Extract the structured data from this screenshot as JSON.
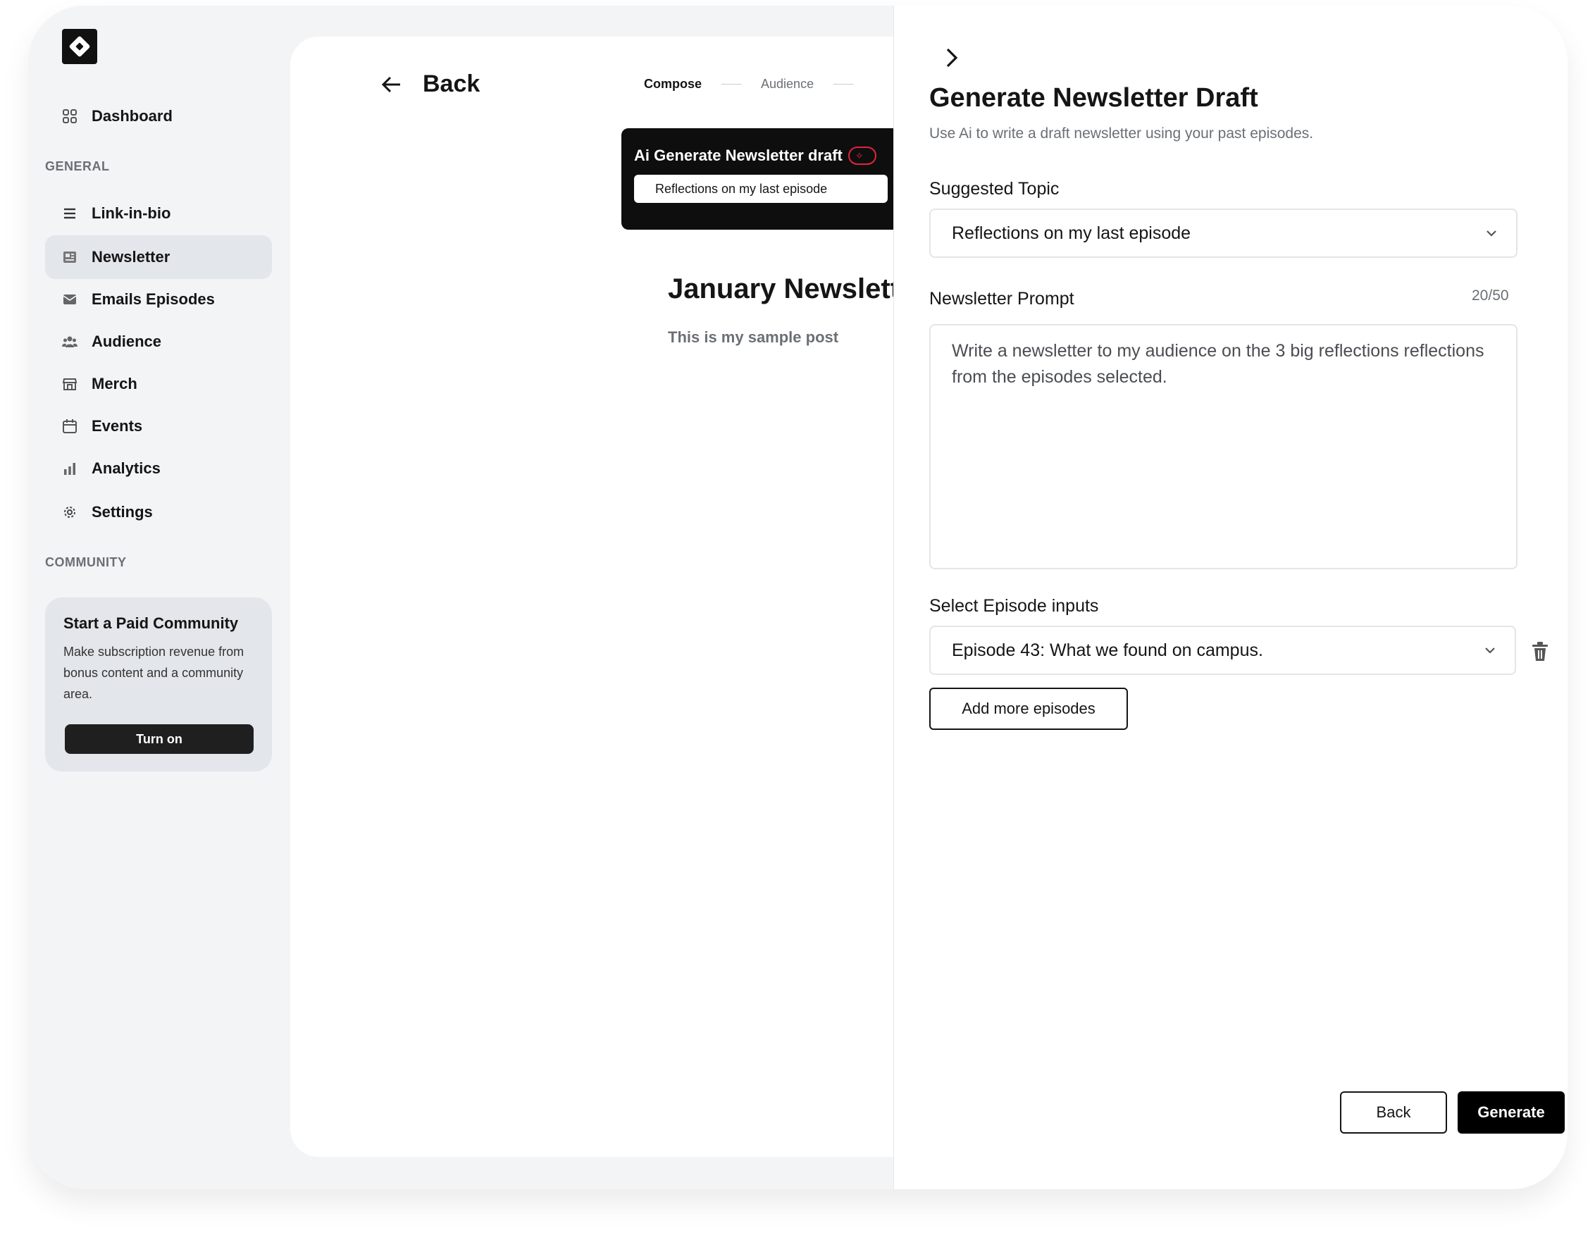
{
  "sidebar": {
    "logo": "logo-diamond",
    "items": [
      {
        "label": "Dashboard",
        "icon": "grid-icon"
      },
      {
        "label": "Link-in-bio",
        "icon": "list-icon"
      },
      {
        "label": "Newsletter",
        "icon": "newspaper-icon",
        "active": true
      },
      {
        "label": "Emails Episodes",
        "icon": "mail-icon"
      },
      {
        "label": "Audience",
        "icon": "people-icon"
      },
      {
        "label": "Merch",
        "icon": "store-icon"
      },
      {
        "label": "Events",
        "icon": "calendar-icon"
      },
      {
        "label": "Analytics",
        "icon": "bar-chart-icon"
      },
      {
        "label": "Settings",
        "icon": "gear-icon"
      }
    ],
    "section_general": "GENERAL",
    "section_community": "COMMUNITY",
    "community_card": {
      "title": "Start a Paid Community",
      "text": "Make subscription revenue from bonus content and a community area.",
      "button": "Turn on"
    }
  },
  "main": {
    "back_label": "Back",
    "steps": [
      "Compose",
      "Audience"
    ],
    "ai_box": {
      "title": "Ai Generate Newsletter draft",
      "badge": "✧",
      "pill": "Reflections on my last episode"
    },
    "doc_title": "January Newsletter",
    "doc_sub": "This is my sample post"
  },
  "panel": {
    "title": "Generate Newsletter Draft",
    "subtitle": "Use Ai to write a draft newsletter using your past episodes.",
    "topic_label": "Suggested Topic",
    "topic_value": "Reflections on my last episode",
    "prompt_label": "Newsletter Prompt",
    "prompt_counter": "20/50",
    "prompt_value": "Write a newsletter to my audience on the 3 big reflections reflections from the episodes selected.",
    "episodes_label": "Select Episode inputs",
    "episode_value": "Episode 43: What we found on campus.",
    "add_more": "Add more episodes",
    "back_button": "Back",
    "generate_button": "Generate"
  },
  "colors": {
    "accent_red": "#e2243c",
    "background": "#f3f4f5",
    "active_item": "#e3e6ea"
  }
}
